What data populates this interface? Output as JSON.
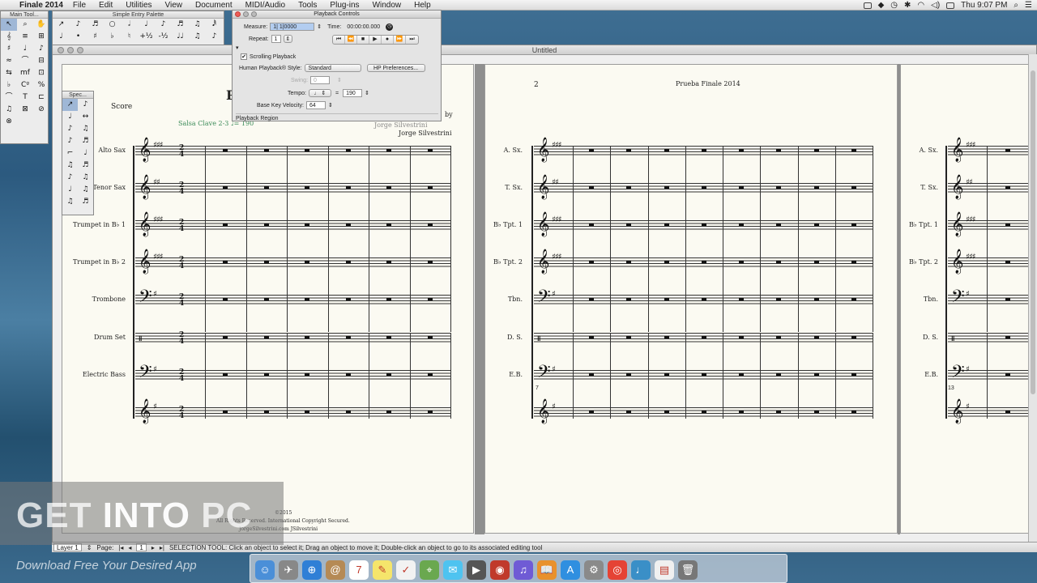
{
  "menubar": {
    "app": "Finale 2014",
    "items": [
      "File",
      "Edit",
      "Utilities",
      "View",
      "Document",
      "MIDI/Audio",
      "Tools",
      "Plug-ins",
      "Window",
      "Help"
    ],
    "clock": "Thu 9:07 PM"
  },
  "main_tool": {
    "title": "Main Tool..."
  },
  "simple_entry": {
    "title": "Simple Entry Palette"
  },
  "special": {
    "title": "Spec..."
  },
  "document": {
    "title": "Untitled"
  },
  "playback": {
    "title": "Playback Controls",
    "measure_label": "Measure:",
    "measure_value": "1| 1|0000",
    "time_label": "Time:",
    "time_value": "00:00:00.000",
    "repeat_label": "Repeat:",
    "repeat_value": "1",
    "scrolling_label": "Scrolling Playback",
    "human_label": "Human Playback® Style:",
    "human_value": "Standard",
    "hp_button": "HP Preferences...",
    "swing_label": "Swing:",
    "swing_value": "0",
    "tempo_label": "Tempo:",
    "tempo_value": "190",
    "tempo_eq": "=",
    "velocity_label": "Base Key Velocity:",
    "velocity_value": "64",
    "region_label": "Playback Region"
  },
  "score_page1": {
    "score_label": "Score",
    "title_fragment": "P",
    "subtitle": "Salsa Clave 2-3  ♩= 190",
    "composer_line1": "Jorge Silvestrini",
    "composer_line2": "Jorge Silvestrini",
    "by_fragment": "by",
    "instruments": [
      "Alto Sax",
      "Tenor Sax",
      "Trumpet in B♭ 1",
      "Trumpet in B♭ 2",
      "Trombone",
      "Drum Set",
      "Electric Bass",
      ""
    ],
    "copyright1": "©2015",
    "copyright2": "All Rights Reserved. International Copyright Secured.",
    "copyright3": "JorgeSilvestrini.com  JSilvestrini"
  },
  "score_page2": {
    "page_number": "2",
    "header": "Prueba Finale 2014",
    "instruments": [
      "A. Sx.",
      "T. Sx.",
      "B♭ Tpt. 1",
      "B♭ Tpt. 2",
      "Tbn.",
      "D. S.",
      "E.B.",
      ""
    ],
    "measure_number": "7"
  },
  "score_page3": {
    "instruments": [
      "A. Sx.",
      "T. Sx.",
      "B♭ Tpt. 1",
      "B♭ Tpt. 2",
      "Tbn.",
      "D. S.",
      "E.B.",
      ""
    ],
    "measure_number": "13"
  },
  "statusbar": {
    "layer": "Layer 1",
    "page_label": "Page:",
    "page_value": "1",
    "message": "SELECTION TOOL: Click an object to select it; Drag an object to move it; Double-click an object to go to its associated editing tool"
  },
  "watermark": {
    "main_a": "GET ",
    "main_b": "INTO",
    "main_c": " PC",
    "sub": "Download Free Your Desired App"
  },
  "dock": {
    "icons": [
      "finder-icon",
      "launchpad-icon",
      "safari-icon",
      "contacts-icon",
      "calendar-icon",
      "notes-icon",
      "reminders-icon",
      "maps-icon",
      "messages-icon",
      "facetime-icon",
      "photobooth-icon",
      "itunes-icon",
      "ibooks-icon",
      "appstore-icon",
      "preferences-icon",
      "chrome-icon",
      "finale-icon",
      "documents-icon",
      "trash-icon"
    ],
    "calendar_day": "7"
  },
  "colors": {
    "paper": "#fbfaf2",
    "desktop": "#3f6f93",
    "selection": "#9fb7d6"
  }
}
